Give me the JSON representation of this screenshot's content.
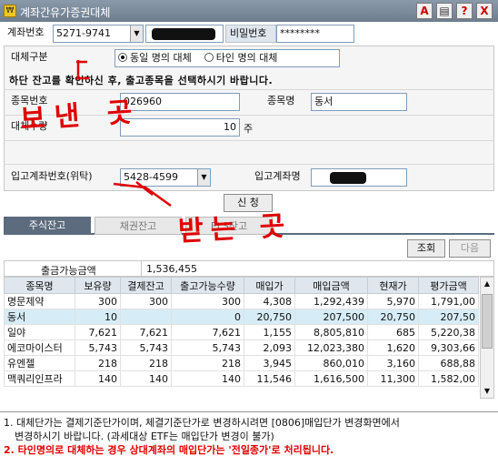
{
  "window": {
    "title": "계좌간유가증권대체",
    "buttons": [
      "A",
      "",
      "?",
      "X"
    ]
  },
  "account": {
    "label": "계좌번호",
    "number": "5271-9741",
    "password_label": "비밀번호",
    "password_value": "********"
  },
  "transfer_type": {
    "label": "대체구분",
    "option_same": "동일 명의 대체",
    "option_other": "타인 명의 대체",
    "selected": "same"
  },
  "instruction": "하단 잔고를 확인하신 후, 출고종목을 선택하시기 바랍니다.",
  "stock": {
    "code_label": "종목번호",
    "code_value": "026960",
    "name_label": "종목명",
    "name_value": "동서"
  },
  "quantity": {
    "label": "대체수량",
    "value": "10",
    "unit": "주"
  },
  "receive": {
    "label": "입고계좌번호(위탁)",
    "account_value": "5428-4599",
    "name_label": "입고계좌명"
  },
  "submit_label": "신 청",
  "tabs": [
    "주식잔고",
    "채권잔고",
    "ELS잔고"
  ],
  "toolbar": {
    "search_label": "조회",
    "next_label": "다음"
  },
  "summary": {
    "label": "출금가능금액",
    "value": "1,536,455"
  },
  "table": {
    "columns": [
      "종목명",
      "보유량",
      "결제잔고",
      "출고가능수량",
      "매입가",
      "매입금액",
      "현재가",
      "평가금액"
    ],
    "rows": [
      [
        "명문제약",
        "300",
        "300",
        "300",
        "4,308",
        "1,292,439",
        "5,970",
        "1,791,00"
      ],
      [
        "동서",
        "10",
        "",
        "0",
        "20,750",
        "207,500",
        "20,750",
        "207,50"
      ],
      [
        "일야",
        "7,621",
        "7,621",
        "7,621",
        "1,155",
        "8,805,810",
        "685",
        "5,220,38"
      ],
      [
        "에코마이스터",
        "5,743",
        "5,743",
        "5,743",
        "2,093",
        "12,023,380",
        "1,620",
        "9,303,66"
      ],
      [
        "유엔젤",
        "218",
        "218",
        "218",
        "3,945",
        "860,010",
        "3,160",
        "688,88"
      ],
      [
        "맥쿼리인프라",
        "140",
        "140",
        "140",
        "11,546",
        "1,616,500",
        "11,300",
        "1,582,00"
      ]
    ]
  },
  "notes": {
    "line1": "1. 대체단가는 결제기준단가이며, 체결기준단가로 변경하시려면 [0806]매입단가 변경화면에서",
    "line2": "변경하시기 바랍니다. (과세대상 ETF는 매입단가 변경이 불가)",
    "line3": "2. 타인명의로 대체하는 경우 상대계좌의 매입단가는 '전일종가'로 처리됩니다."
  },
  "annotations": {
    "send_text": "보낸 곳",
    "receive_text": "받는 곳"
  }
}
